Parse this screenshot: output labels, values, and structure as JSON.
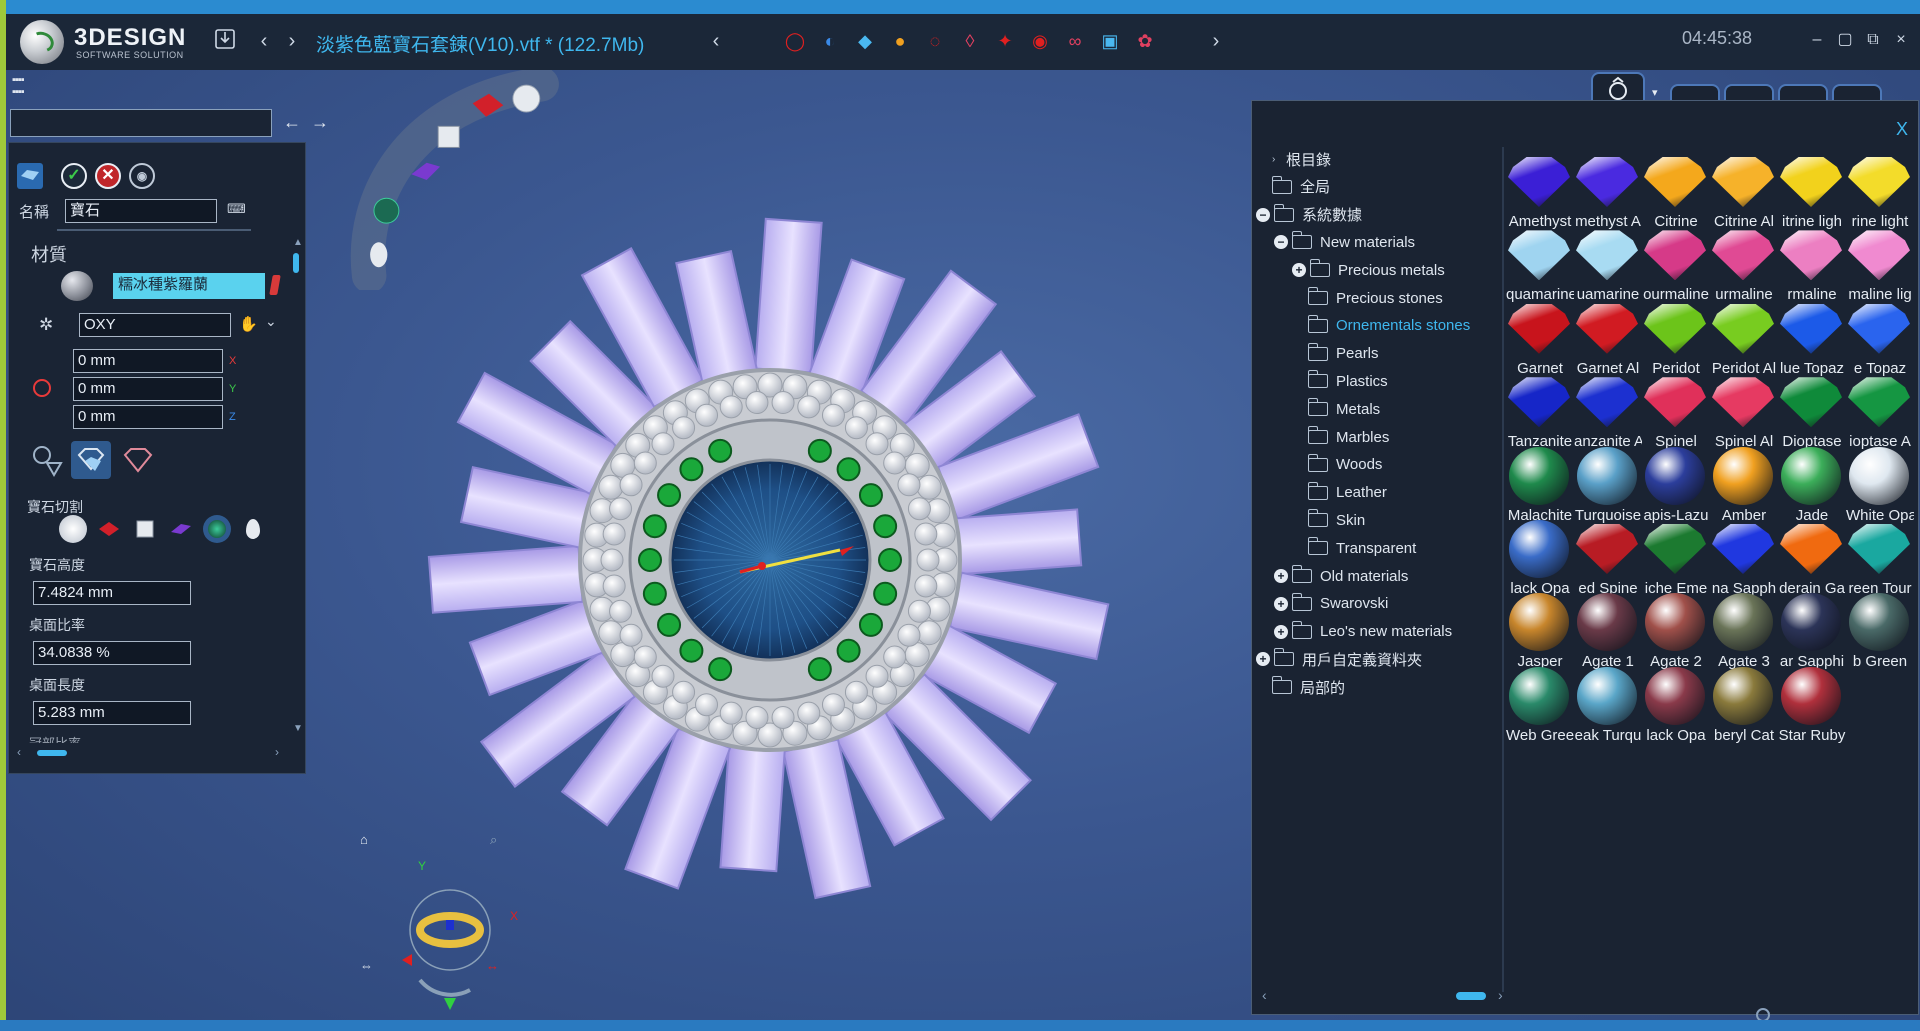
{
  "app": {
    "logo_text": "3DESIGN",
    "logo_sub": "SOFTWARE SOLUTION",
    "file_title": "淡紫色藍寶石套鍊(V10).vtf *  (122.7Mb)",
    "clock": "04:45:38",
    "icons": {
      "save": "save-icon",
      "back": "chevron-left-icon",
      "forward": "chevron-right-icon",
      "gem_tools": [
        "ring-icon",
        "spiral-icon",
        "diamond-icon",
        "colored-gems-icon",
        "pave-icon",
        "drop-icon",
        "cluster-icon",
        "bezel-icon",
        "link-icon",
        "cube-icon",
        "flower-icon"
      ]
    },
    "colors": {
      "title_blue": "#3fb7ee",
      "accent_green": "#9fc93a",
      "panel_bg": "#1a2434"
    }
  },
  "search": {
    "value": ""
  },
  "props": {
    "name_label": "名稱",
    "name_value": "寶石",
    "material_label": "材質",
    "material_value": "糯冰種紫羅蘭",
    "coord_system": "OXY",
    "x_value": "0 mm",
    "y_value": "0 mm",
    "z_value": "0 mm",
    "axis_x": "X",
    "axis_y": "Y",
    "axis_z": "Z",
    "cut_label": "寶石切割",
    "height_label": "寶石高度",
    "height_value": "7.4824 mm",
    "table_ratio_label": "桌面比率",
    "table_ratio_value": "34.0838 %",
    "table_length_label": "桌面長度",
    "table_length_value": "5.283 mm",
    "cut_partial_label": "冠部比率"
  },
  "viewport": {
    "gizmo": {
      "y_label": "Y",
      "x_label": "X"
    }
  },
  "materials": {
    "close": "X",
    "tree": [
      {
        "label": "根目錄",
        "level": 0,
        "exp": "",
        "folder": false
      },
      {
        "label": "全局",
        "level": 0,
        "exp": "",
        "folder": true
      },
      {
        "label": "系統數據",
        "level": 0,
        "exp": "−",
        "folder": true
      },
      {
        "label": "New materials",
        "level": 1,
        "exp": "−",
        "folder": true
      },
      {
        "label": "Precious metals",
        "level": 2,
        "exp": "+",
        "folder": true
      },
      {
        "label": "Precious stones",
        "level": 2,
        "exp": "",
        "folder": true
      },
      {
        "label": "Ornementals stones",
        "level": 2,
        "exp": "",
        "folder": true,
        "active": true
      },
      {
        "label": "Pearls",
        "level": 2,
        "exp": "",
        "folder": true
      },
      {
        "label": "Plastics",
        "level": 2,
        "exp": "",
        "folder": true
      },
      {
        "label": "Metals",
        "level": 2,
        "exp": "",
        "folder": true
      },
      {
        "label": "Marbles",
        "level": 2,
        "exp": "",
        "folder": true
      },
      {
        "label": "Woods",
        "level": 2,
        "exp": "",
        "folder": true
      },
      {
        "label": "Leather",
        "level": 2,
        "exp": "",
        "folder": true
      },
      {
        "label": "Skin",
        "level": 2,
        "exp": "",
        "folder": true
      },
      {
        "label": "Transparent",
        "level": 2,
        "exp": "",
        "folder": true
      },
      {
        "label": "Old materials",
        "level": 1,
        "exp": "+",
        "folder": true
      },
      {
        "label": "Swarovski",
        "level": 1,
        "exp": "+",
        "folder": true
      },
      {
        "label": "Leo's new materials",
        "level": 1,
        "exp": "+",
        "folder": true
      },
      {
        "label": "用戶自定義資料夾",
        "level": 0,
        "exp": "+",
        "folder": true
      },
      {
        "label": "局部的",
        "level": 0,
        "exp": "",
        "folder": true
      }
    ],
    "swatches": [
      {
        "label": "Amethyst",
        "color": "#3b1fd6",
        "kind": "gem"
      },
      {
        "label": "methyst A",
        "color": "#4a2ae0",
        "kind": "gem"
      },
      {
        "label": "Citrine",
        "color": "#f4a81c",
        "kind": "gem"
      },
      {
        "label": "Citrine Al",
        "color": "#f6b22a",
        "kind": "gem"
      },
      {
        "label": "itrine ligh",
        "color": "#f2d21c",
        "kind": "gem"
      },
      {
        "label": "rine light",
        "color": "#f3dc2a",
        "kind": "gem"
      },
      {
        "label": "quamarine",
        "color": "#9fd4f0",
        "kind": "gem"
      },
      {
        "label": "uamarine",
        "color": "#a8dbf2",
        "kind": "gem"
      },
      {
        "label": "ourmaline",
        "color": "#d63a88",
        "kind": "gem"
      },
      {
        "label": "urmaline",
        "color": "#e04a94",
        "kind": "gem"
      },
      {
        "label": "rmaline",
        "color": "#ec7fc2",
        "kind": "gem"
      },
      {
        "label": "maline lig",
        "color": "#f08ad0",
        "kind": "gem"
      },
      {
        "label": "Garnet",
        "color": "#c8141c",
        "kind": "gem"
      },
      {
        "label": "Garnet Al",
        "color": "#d11b22",
        "kind": "gem"
      },
      {
        "label": "Peridot",
        "color": "#6cc41a",
        "kind": "gem"
      },
      {
        "label": "Peridot Al",
        "color": "#78cc20",
        "kind": "gem"
      },
      {
        "label": "lue Topaz",
        "color": "#1c5ae8",
        "kind": "gem"
      },
      {
        "label": "e Topaz",
        "color": "#2a64ee",
        "kind": "gem"
      },
      {
        "label": "Tanzanite",
        "color": "#1626c8",
        "kind": "gem"
      },
      {
        "label": "anzanite A",
        "color": "#1c30d0",
        "kind": "gem"
      },
      {
        "label": "Spinel",
        "color": "#e0305a",
        "kind": "gem"
      },
      {
        "label": "Spinel Al",
        "color": "#e63a62",
        "kind": "gem"
      },
      {
        "label": "Dioptase",
        "color": "#0f8a3a",
        "kind": "gem"
      },
      {
        "label": "ioptase A",
        "color": "#159642",
        "kind": "gem"
      },
      {
        "label": "Malachite",
        "color": "#1f8a4c",
        "kind": "ball"
      },
      {
        "label": "Turquoise",
        "color": "#5aa0c8",
        "kind": "ball"
      },
      {
        "label": "apis-Lazu",
        "color": "#2c3e9c",
        "kind": "ball"
      },
      {
        "label": "Amber",
        "color": "#f0a020",
        "kind": "ball"
      },
      {
        "label": "Jade",
        "color": "#3cae5a",
        "kind": "ball"
      },
      {
        "label": "White Opa",
        "color": "#dfe8f0",
        "kind": "ball"
      },
      {
        "label": "lack Opa",
        "color": "#3a6cc8",
        "kind": "ball"
      },
      {
        "label": "ed Spine",
        "color": "#b81c24",
        "kind": "gem"
      },
      {
        "label": "iche Eme",
        "color": "#1c7a30",
        "kind": "gem"
      },
      {
        "label": "na Sapph",
        "color": "#2038e0",
        "kind": "gem"
      },
      {
        "label": "derain Ga",
        "color": "#f06a10",
        "kind": "gem"
      },
      {
        "label": "reen Tour",
        "color": "#1aa8a0",
        "kind": "gem"
      },
      {
        "label": "Jasper",
        "color": "#c8862c",
        "kind": "ball"
      },
      {
        "label": "Agate 1",
        "color": "#6a3a48",
        "kind": "ball"
      },
      {
        "label": "Agate 2",
        "color": "#a0504a",
        "kind": "ball"
      },
      {
        "label": "Agate 3",
        "color": "#6a7458",
        "kind": "ball"
      },
      {
        "label": "ar Sapphi",
        "color": "#2c3458",
        "kind": "ball"
      },
      {
        "label": "b Green",
        "color": "#4a6a68",
        "kind": "ball"
      },
      {
        "label": "Web Gree",
        "color": "#2a8a6a",
        "kind": "ball"
      },
      {
        "label": "eak Turqu",
        "color": "#5aa6c8",
        "kind": "ball"
      },
      {
        "label": "lack Opa",
        "color": "#8a3a4a",
        "kind": "ball"
      },
      {
        "label": "beryl Cat",
        "color": "#8a7a3c",
        "kind": "ball"
      },
      {
        "label": "Star Ruby",
        "color": "#b0303c",
        "kind": "ball"
      }
    ]
  }
}
